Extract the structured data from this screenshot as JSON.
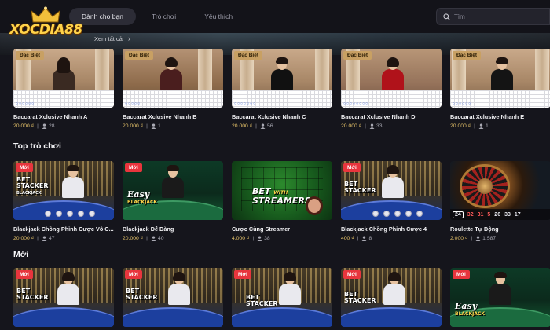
{
  "brand": {
    "logo_text": "XOCDIA88"
  },
  "nav": {
    "tabs": [
      {
        "label": "Dành cho bạn",
        "active": true
      },
      {
        "label": "Trò chơi",
        "active": false
      },
      {
        "label": "Yêu thích",
        "active": false
      }
    ]
  },
  "search": {
    "placeholder": "Tìm"
  },
  "featured": {
    "see_all": "Xem tất cả",
    "cards": [
      {
        "badge": "Đặc Biệt",
        "title": "Baccarat Xclusive Nhanh A",
        "price": "20.000 ₫",
        "players": "28"
      },
      {
        "badge": "Đặc Biệt",
        "title": "Baccarat Xclusive Nhanh B",
        "price": "20.000 ₫",
        "players": "1"
      },
      {
        "badge": "Đặc Biệt",
        "title": "Baccarat Xclusive Nhanh C",
        "price": "20.000 ₫",
        "players": "56"
      },
      {
        "badge": "Đặc Biệt",
        "title": "Baccarat Xclusive Nhanh D",
        "price": "20.000 ₫",
        "players": "33"
      },
      {
        "badge": "Đặc Biệt",
        "title": "Baccarat Xclusive Nhanh E",
        "price": "20.000 ₫",
        "players": "1"
      }
    ]
  },
  "top_games": {
    "title": "Top trò chơi",
    "cards": [
      {
        "badge": "Mới",
        "title": "Blackjack Chồng Phỉnh Cược Vô C...",
        "price": "20.000 ₫",
        "players": "47",
        "art": "BET STACKER"
      },
      {
        "badge": "Mới",
        "title": "Blackjack Dễ Dàng",
        "price": "20.000 ₫",
        "players": "40",
        "art": "Easy"
      },
      {
        "badge": "",
        "title": "Cược Cùng Streamer",
        "price": "4.000 ₫",
        "players": "38",
        "art": "BET STREAMERS"
      },
      {
        "badge": "Mới",
        "title": "Blackjack Chồng Phỉnh Cược 4",
        "price": "400 ₫",
        "players": "8",
        "art": "BET STACKER"
      },
      {
        "badge": "",
        "title": "Roulette Tự Động",
        "price": "2.000 ₫",
        "players": "1.587",
        "art": "roulette"
      }
    ],
    "roulette_numbers": [
      "24",
      "32",
      "31",
      "5",
      "26",
      "33",
      "17"
    ]
  },
  "new_games": {
    "title": "Mới",
    "cards": [
      {
        "badge": "Mới",
        "art": "BET STACKER"
      },
      {
        "badge": "Mới",
        "art": "BET STACKER"
      },
      {
        "badge": "Mới",
        "art": "BET STACKER"
      },
      {
        "badge": "Mới",
        "art": "BET STACKER"
      },
      {
        "badge": "Mới",
        "art": "Easy"
      }
    ]
  },
  "art_text": {
    "bet": "BET",
    "stacker": "STACKER",
    "blackjack": "BLACKJACK",
    "easy": "Easy",
    "with": "WITH",
    "streamers": "STREAMERS"
  },
  "colors": {
    "accent_gold": "#e6c36a",
    "badge_special": "#c8a063",
    "badge_new": "#e8353d",
    "background": "#15151c"
  }
}
